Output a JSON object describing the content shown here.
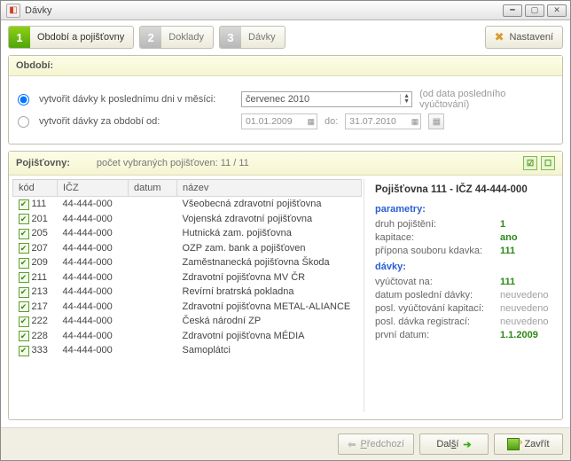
{
  "window": {
    "title": "Dávky"
  },
  "wizard": {
    "steps": [
      {
        "num": "1",
        "label": "Období a pojišťovny"
      },
      {
        "num": "2",
        "label": "Doklady"
      },
      {
        "num": "3",
        "label": "Dávky"
      }
    ],
    "settings_label": "Nastavení"
  },
  "period": {
    "title": "Období:",
    "opt_month_label": "vytvořit dávky k poslednímu dni v měsíci:",
    "month_value": "červenec 2010",
    "month_hint": "(od data posledního vyúčtování)",
    "opt_range_label": "vytvořit dávky za období od:",
    "date_from": "01.01.2009",
    "date_to_label": "do:",
    "date_to": "31.07.2010"
  },
  "insurers": {
    "title": "Pojišťovny:",
    "count_label": "počet vybraných pojišťoven: 11 / 11",
    "columns": {
      "code": "kód",
      "icz": "IČZ",
      "date": "datum",
      "name": "název"
    },
    "rows": [
      {
        "code": "111",
        "icz": "44-444-000",
        "date": "",
        "name": "Všeobecná zdravotní pojišťovna"
      },
      {
        "code": "201",
        "icz": "44-444-000",
        "date": "",
        "name": "Vojenská zdravotní pojišťovna"
      },
      {
        "code": "205",
        "icz": "44-444-000",
        "date": "",
        "name": "Hutnická zam. pojišťovna"
      },
      {
        "code": "207",
        "icz": "44-444-000",
        "date": "",
        "name": "OZP zam. bank a pojišťoven"
      },
      {
        "code": "209",
        "icz": "44-444-000",
        "date": "",
        "name": "Zaměstnanecká pojišťovna Škoda"
      },
      {
        "code": "211",
        "icz": "44-444-000",
        "date": "",
        "name": "Zdravotní pojišťovna MV ČR"
      },
      {
        "code": "213",
        "icz": "44-444-000",
        "date": "",
        "name": "Revírní bratrská pokladna"
      },
      {
        "code": "217",
        "icz": "44-444-000",
        "date": "",
        "name": "Zdravotní pojišťovna METAL-ALIANCE"
      },
      {
        "code": "222",
        "icz": "44-444-000",
        "date": "",
        "name": "Česká národní ZP"
      },
      {
        "code": "228",
        "icz": "44-444-000",
        "date": "",
        "name": "Zdravotní pojišťovna MÉDIA"
      },
      {
        "code": "333",
        "icz": "44-444-000",
        "date": "",
        "name": "Samoplátci"
      }
    ]
  },
  "details": {
    "title": "Pojišťovna 111 - IČZ 44-444-000",
    "params_title": "parametry:",
    "params": {
      "druh_k": "druh pojištění:",
      "druh_v": "1",
      "kap_k": "kapitace:",
      "kap_v": "ano",
      "suff_k": "přípona souboru kdavka:",
      "suff_v": "111"
    },
    "batches_title": "dávky:",
    "batches": {
      "bill_k": "vyúčtovat na:",
      "bill_v": "111",
      "last_k": "datum poslední dávky:",
      "last_v": "neuvedeno",
      "kap_k": "posl. vyúčtování kapitací:",
      "kap_v": "neuvedeno",
      "reg_k": "posl. dávka registrací:",
      "reg_v": "neuvedeno",
      "first_k": "první datum:",
      "first_v": "1.1.2009"
    }
  },
  "footer": {
    "prev": "Předchozí",
    "next": "Další",
    "close": "Zavřít"
  }
}
